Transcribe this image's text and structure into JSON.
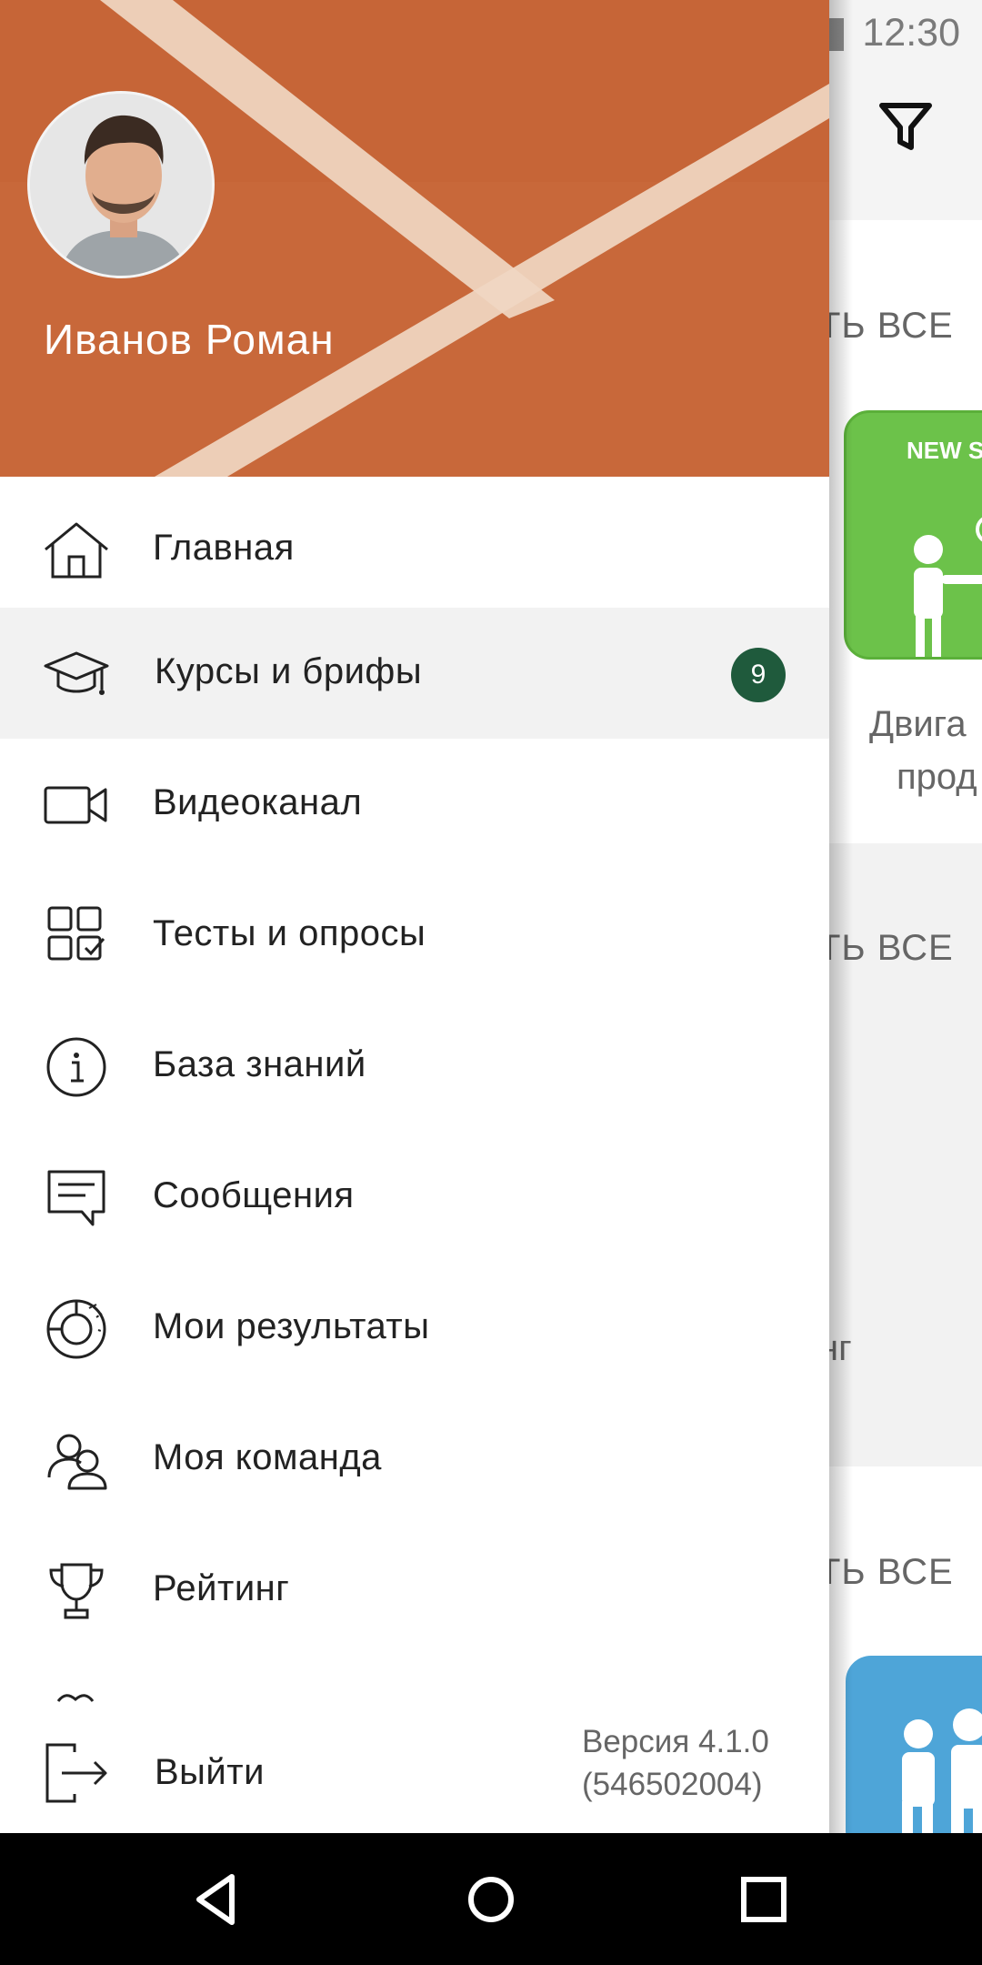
{
  "status_bar": {
    "time": "12:30"
  },
  "background_app": {
    "see_all_1": "ТЬ ВСЕ",
    "see_all_2": "ТЬ ВСЕ",
    "see_all_3": "ТЬ ВСЕ",
    "rating_partial": "нг",
    "card_badge_text": "NEW SA",
    "card_title_line1": "Двига",
    "card_title_line2": "прод"
  },
  "drawer": {
    "user_name": "Иванов Роман",
    "menu": [
      {
        "label": "Главная",
        "icon": "home-icon"
      },
      {
        "label": "Курсы и брифы",
        "icon": "graduation-cap-icon",
        "badge": "9"
      },
      {
        "label": "Видеоканал",
        "icon": "video-camera-icon"
      },
      {
        "label": "Тесты и опросы",
        "icon": "tests-grid-icon"
      },
      {
        "label": "База знаний",
        "icon": "info-icon"
      },
      {
        "label": "Сообщения",
        "icon": "message-icon"
      },
      {
        "label": "Мои результаты",
        "icon": "results-chart-icon"
      },
      {
        "label": "Моя команда",
        "icon": "team-icon"
      },
      {
        "label": "Рейтинг",
        "icon": "trophy-icon"
      }
    ],
    "logout_label": "Выйти",
    "version_line1": "Версия 4.1.0",
    "version_line2": "(546502004)"
  },
  "colors": {
    "header_clay": "#c8683a",
    "badge_green": "#1f5a3c",
    "card_green": "#6cc24a",
    "card_blue": "#4ea5d8"
  }
}
